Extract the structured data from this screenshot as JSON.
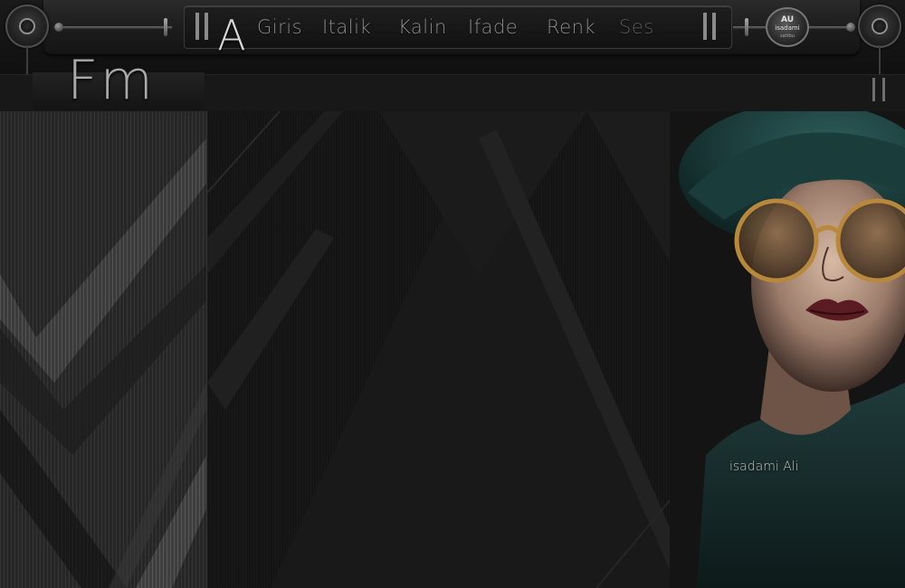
{
  "header": {
    "logo_letter": "A",
    "menu": [
      {
        "label": "Giris"
      },
      {
        "label": "Italik"
      },
      {
        "label": "Kalin"
      },
      {
        "label": "Ifade"
      },
      {
        "label": "Renk"
      },
      {
        "label": "Ses"
      }
    ],
    "badge": {
      "line1": "AU",
      "line2": "isadami",
      "line3": "sattbu"
    }
  },
  "site_logo": "Fm",
  "signature": "isadami Ali",
  "colors": {
    "background": "#151515",
    "menu_text": "#8c8c8c",
    "hat_teal": "#1f4a48",
    "glasses_gold": "#b8893c"
  }
}
